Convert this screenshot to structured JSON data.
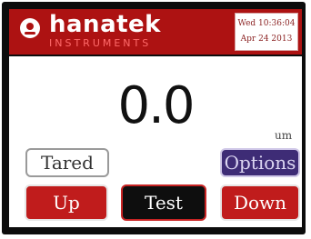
{
  "header": {
    "brand": "hanatek",
    "brand_sub": "INSTRUMENTS",
    "datetime": {
      "line1": "Wed 10:36:04",
      "line2": "Apr 24 2013"
    }
  },
  "display": {
    "reading": "0.0",
    "unit": "um"
  },
  "buttons": {
    "tared": "Tared",
    "options": "Options",
    "up": "Up",
    "test": "Test",
    "down": "Down"
  },
  "colors": {
    "header_red": "#ad1212",
    "button_red": "#c01c1c",
    "options_purple": "#3e2c76",
    "bezel": "#0c0c0c"
  }
}
